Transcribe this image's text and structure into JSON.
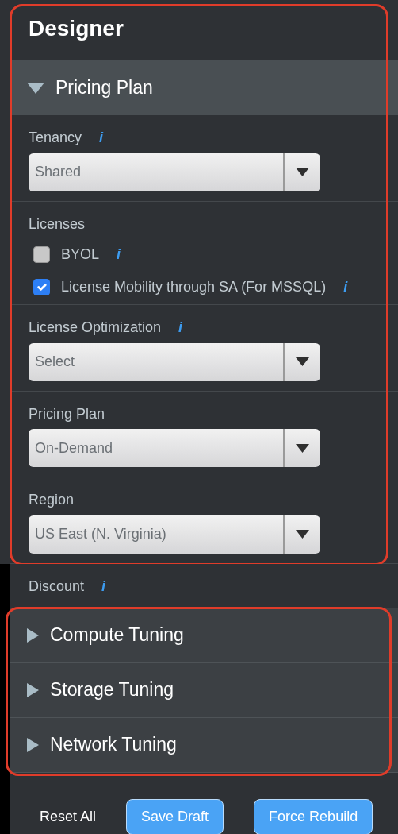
{
  "groups": [
    {
      "highlighted": true,
      "title": "Designer",
      "sections": [
        {
          "title": "Pricing Plan",
          "expanded": true,
          "fields": [
            {
              "kind": "select",
              "label": "Tenancy",
              "info": "i",
              "value": "Shared"
            },
            {
              "kind": "checks",
              "label": "Licenses",
              "options": [
                {
                  "label": "BYOL",
                  "checked": false,
                  "info": "i"
                },
                {
                  "label": "License Mobility through SA (For MSSQL)",
                  "checked": true,
                  "info": "i"
                }
              ]
            },
            {
              "kind": "select",
              "label": "License Optimization",
              "info": "i",
              "value": "Select"
            },
            {
              "kind": "select",
              "label": "Pricing Plan",
              "value": "On-Demand"
            },
            {
              "kind": "select",
              "label": "Region",
              "value": "US East (N. Virginia)"
            }
          ]
        }
      ]
    },
    {
      "fields": [
        {
          "kind": "plain",
          "label": "Discount",
          "info": "i"
        }
      ]
    },
    {
      "highlighted": true,
      "sections": [
        {
          "title": "Compute Tuning",
          "expanded": false
        },
        {
          "title": "Storage Tuning",
          "expanded": false
        },
        {
          "title": "Network Tuning",
          "expanded": false
        }
      ]
    }
  ],
  "buttons": [
    {
      "label": "Reset All",
      "kind": "link"
    },
    {
      "label": "Save Draft",
      "kind": "primary"
    },
    {
      "label": "Force Rebuild",
      "kind": "primary"
    }
  ]
}
